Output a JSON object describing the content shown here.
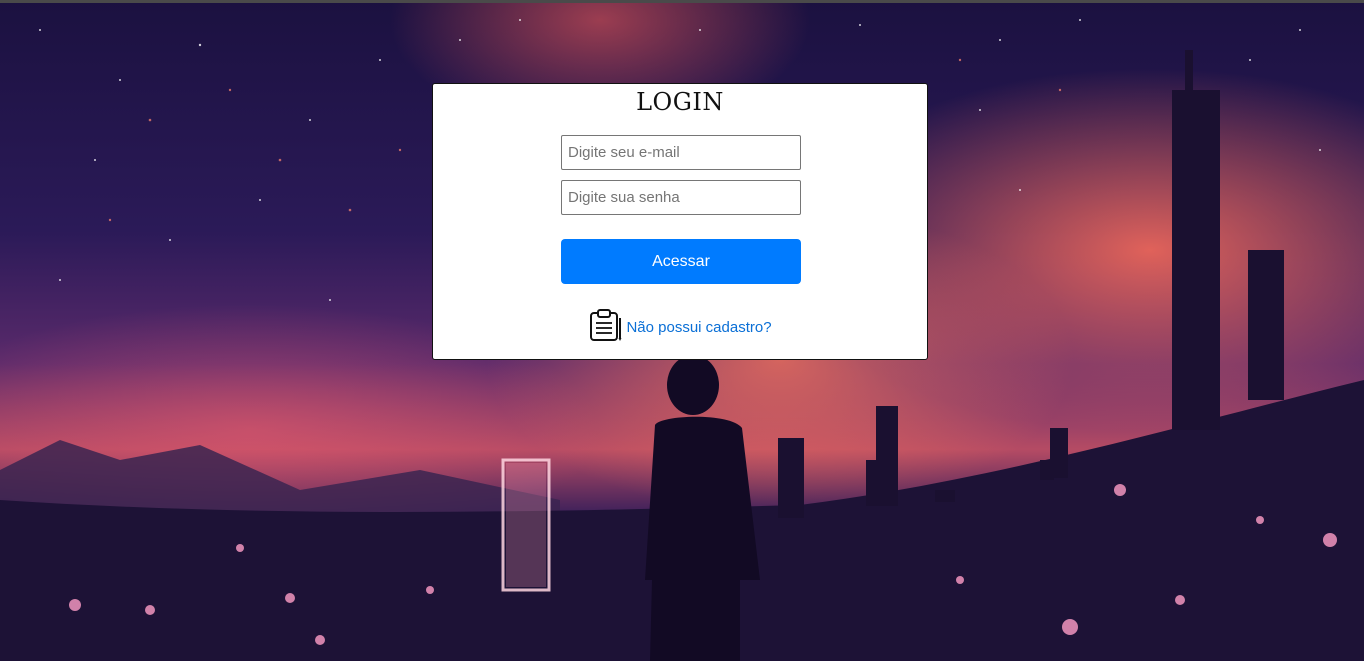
{
  "login": {
    "title": "LOGIN",
    "email_placeholder": "Digite seu e-mail",
    "senha_placeholder": "Digite sua senha",
    "submit_label": "Acessar",
    "signup_link": "Não possui cadastro?",
    "signup_icon": "clipboard-icon"
  },
  "colors": {
    "button": "#007bff",
    "link": "#0a6fd6",
    "panel": "#ffffff"
  }
}
